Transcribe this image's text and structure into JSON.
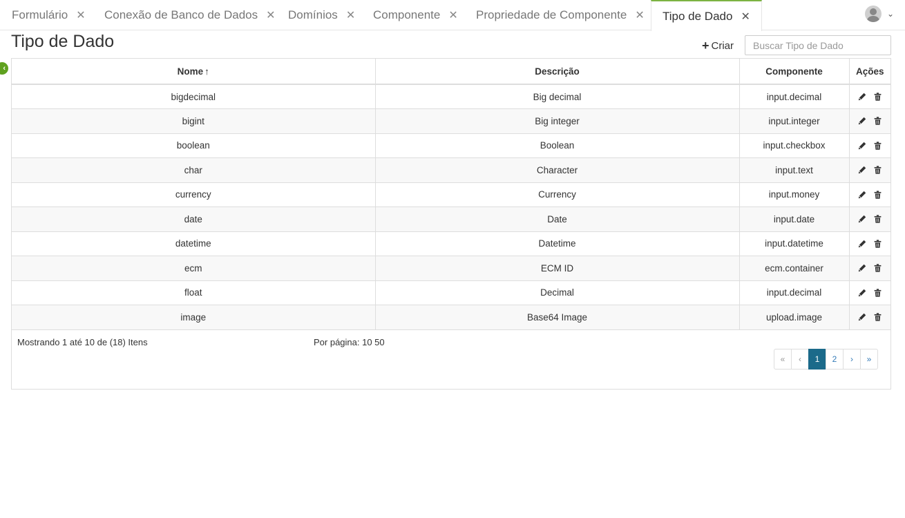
{
  "tabs": [
    {
      "label": "Formulário",
      "close": "✕"
    },
    {
      "label": "Conexão de Banco de Dados",
      "close": "✕"
    },
    {
      "label": "Domínios",
      "close": "✕"
    },
    {
      "label": "Componente",
      "close": "✕"
    },
    {
      "label": "Propriedade de Componente",
      "close": "✕"
    },
    {
      "label": "Tipo de Dado",
      "close": "✕",
      "active": true
    }
  ],
  "user": {
    "caret": "⌄"
  },
  "page": {
    "title": "Tipo de Dado",
    "create_label": "Criar",
    "create_icon": "+",
    "search_placeholder": "Buscar Tipo de Dado"
  },
  "table": {
    "headers": {
      "name": "Nome",
      "sort_icon": "↑",
      "description": "Descrição",
      "component": "Componente",
      "actions": "Ações"
    },
    "rows": [
      {
        "name": "bigdecimal",
        "description": "Big decimal",
        "component": "input.decimal"
      },
      {
        "name": "bigint",
        "description": "Big integer",
        "component": "input.integer"
      },
      {
        "name": "boolean",
        "description": "Boolean",
        "component": "input.checkbox"
      },
      {
        "name": "char",
        "description": "Character",
        "component": "input.text"
      },
      {
        "name": "currency",
        "description": "Currency",
        "component": "input.money"
      },
      {
        "name": "date",
        "description": "Date",
        "component": "input.date"
      },
      {
        "name": "datetime",
        "description": "Datetime",
        "component": "input.datetime"
      },
      {
        "name": "ecm",
        "description": "ECM ID",
        "component": "ecm.container"
      },
      {
        "name": "float",
        "description": "Decimal",
        "component": "input.decimal"
      },
      {
        "name": "image",
        "description": "Base64 Image",
        "component": "upload.image"
      }
    ]
  },
  "footer": {
    "showing": "Mostrando 1 até 10 de (18) Itens",
    "per_page": "Por página: 10 50"
  },
  "pagination": {
    "first": "«",
    "prev": "‹",
    "pages": [
      "1",
      "2"
    ],
    "current": "1",
    "next": "›",
    "last": "»"
  },
  "colors": {
    "accent": "#7cb342",
    "pager_active": "#1b6a8a",
    "collapse": "#5fa11f"
  }
}
